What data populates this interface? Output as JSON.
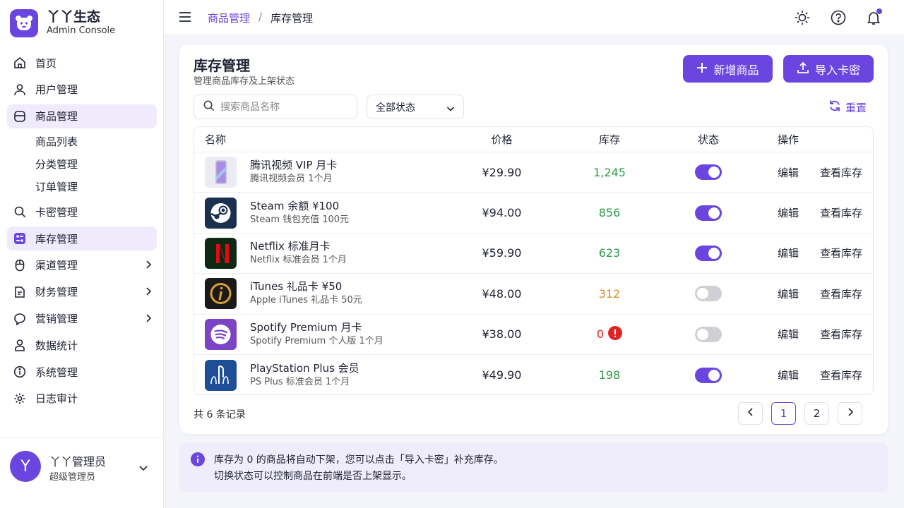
{
  "brand": {
    "name": "丫丫生态",
    "sub": "Admin Console"
  },
  "nav": {
    "home": "首页",
    "users": "用户管理",
    "products": "商品管理",
    "sub": {
      "list": "商品列表",
      "category": "分类管理",
      "orders": "订单管理"
    },
    "cards": "卡密管理",
    "inventory": "库存管理",
    "channels": "渠道管理",
    "finance": "财务管理",
    "marketing": "营销管理",
    "stats": "数据统计",
    "system": "系统管理",
    "audit": "日志审计"
  },
  "user": {
    "initial": "Y",
    "name": "丫丫管理员",
    "role": "超级管理员"
  },
  "breadcrumb": {
    "parent": "商品管理",
    "sep": "/",
    "current": "库存管理"
  },
  "page": {
    "title": "库存管理",
    "subtitle": "管理商品库存及上架状态"
  },
  "actions": {
    "add": "新增商品",
    "import": "导入卡密",
    "reset": "重置"
  },
  "filters": {
    "search_placeholder": "搜索商品名称",
    "status_value": "全部状态"
  },
  "table": {
    "headers": {
      "name": "名称",
      "price": "价格",
      "stock": "库存",
      "status": "状态",
      "ops": "操作"
    },
    "ops": {
      "edit": "编辑",
      "view": "查看库存"
    },
    "rows": [
      {
        "name": "腾讯视频 VIP 月卡",
        "desc": "腾讯视频会员 1个月",
        "price": "¥29.90",
        "stock": "1,245",
        "stock_color": "#2e9a4a",
        "on": true,
        "icon": "phone-thumbnail-icon"
      },
      {
        "name": "Steam 余额 ¥100",
        "desc": "Steam 钱包充值 100元",
        "price": "¥94.00",
        "stock": "856",
        "stock_color": "#2e9a4a",
        "on": true,
        "icon": "steam-icon"
      },
      {
        "name": "Netflix 标准月卡",
        "desc": "Netflix 标准会员 1个月",
        "price": "¥59.90",
        "stock": "623",
        "stock_color": "#2e9a4a",
        "on": true,
        "icon": "netflix-icon"
      },
      {
        "name": "iTunes 礼品卡 ¥50",
        "desc": "Apple iTunes 礼品卡 50元",
        "price": "¥48.00",
        "stock": "312",
        "stock_color": "#e08a1e",
        "on": false,
        "icon": "itunes-icon"
      },
      {
        "name": "Spotify Premium 月卡",
        "desc": "Spotify Premium 个人版 1个月",
        "price": "¥38.00",
        "stock": "0",
        "stock_color": "#e02424",
        "on": false,
        "icon": "spotify-icon",
        "alert": true
      },
      {
        "name": "PlayStation Plus 会员",
        "desc": "PS Plus 标准会员 1个月",
        "price": "¥49.90",
        "stock": "198",
        "stock_color": "#2e9a4a",
        "on": true,
        "icon": "playstation-icon"
      }
    ]
  },
  "footer": {
    "total": "共 6 条记录",
    "pages": [
      "1",
      "2"
    ],
    "current_page": "1"
  },
  "notice": {
    "line1": "库存为 0 的商品将自动下架，您可以点击「导入卡密」补充库存。",
    "line2": "切换状态可以控制商品在前端是否上架显示。"
  },
  "colors": {
    "accent": "#6a45e0",
    "ok": "#2e9a4a",
    "warn": "#e08a1e",
    "danger": "#e02424"
  }
}
